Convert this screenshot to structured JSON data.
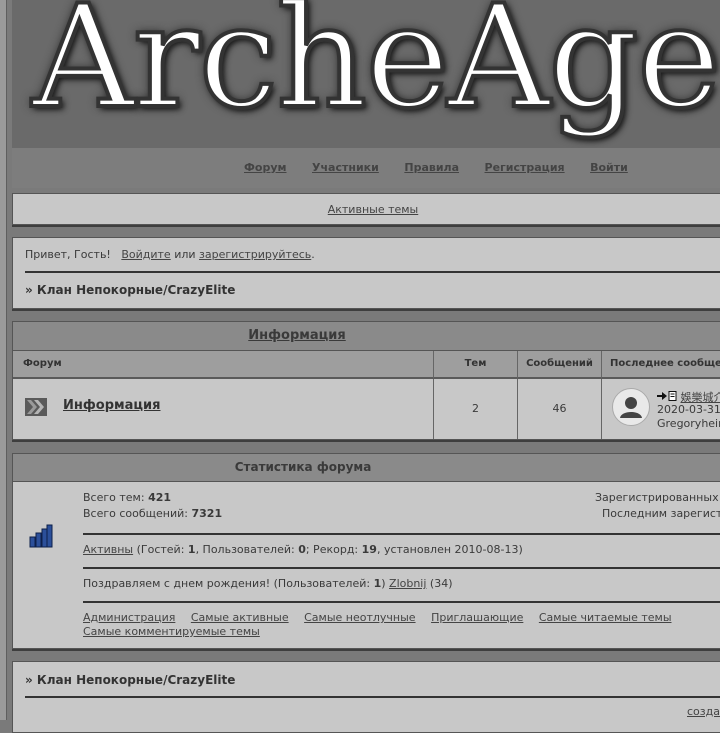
{
  "banner": {
    "title": "ArcheAge"
  },
  "nav": [
    "Форум",
    "Участники",
    "Правила",
    "Регистрация",
    "Войти"
  ],
  "active_topics": "Активные темы",
  "welcome": {
    "greeting": "Привет, Гость!",
    "login": "Войдите",
    "or": "или",
    "register": "зарегистрируйтесь",
    "period": "."
  },
  "breadcrumb": "» Клан Непокорные/CrazyElite",
  "forum": {
    "category": "Информация",
    "headers": {
      "forum": "Форум",
      "topics": "Тем",
      "posts": "Сообщений",
      "last_post": "Последнее сообще"
    },
    "row": {
      "name": "Информация",
      "topics": "2",
      "posts": "46",
      "last_title": "娛樂城介",
      "last_date": "2020-03-31",
      "last_user": "Gregoryhein"
    }
  },
  "stats": {
    "title": "Статистика форума",
    "topics_label": "Всего тем:",
    "topics_value": "421",
    "posts_label": "Всего сообщений:",
    "posts_value": "7321",
    "registered_label": "Зарегистрированных",
    "last_registered_label": "Последним зарегист",
    "active_link": "Активны",
    "online_text_1": " (Гостей: ",
    "guests": "1",
    "online_text_2": ", Пользователей: ",
    "users": "0",
    "online_text_3": "; Рекорд: ",
    "record": "19",
    "online_text_4": ", установлен 2010-08-13)",
    "birthday_text": "Поздравляем с днем рождения! (Пользователей: ",
    "birthday_count": "1",
    "birthday_close": ")",
    "birthday_user": "Zlobnij",
    "birthday_age": "(34)",
    "links": [
      "Администрация",
      "Самые активные",
      "Самые неотлучные",
      "Приглашающие",
      "Самые читаемые темы",
      "Самые комментируемые темы"
    ]
  },
  "footer": {
    "create_link": "созда"
  },
  "colors": {
    "background": "#7a7a7a",
    "panel": "#c8c8c8",
    "header": "#8a8a8a"
  }
}
